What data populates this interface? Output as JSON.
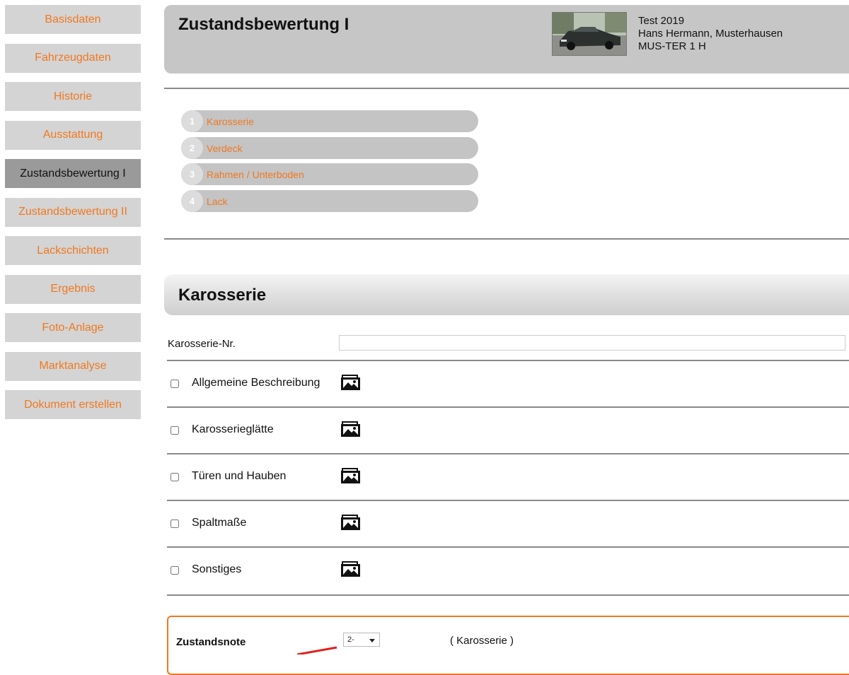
{
  "sidebar": {
    "items": [
      {
        "label": "Basisdaten"
      },
      {
        "label": "Fahrzeugdaten"
      },
      {
        "label": "Historie"
      },
      {
        "label": "Ausstattung"
      },
      {
        "label": "Zustandsbewertung I",
        "active": true
      },
      {
        "label": "Zustandsbewertung II"
      },
      {
        "label": "Lackschichten"
      },
      {
        "label": "Ergebnis"
      },
      {
        "label": "Foto-Anlage"
      },
      {
        "label": "Marktanalyse"
      },
      {
        "label": "Dokument erstellen"
      }
    ]
  },
  "header": {
    "title": "Zustandsbewertung I",
    "info_line1": "Test 2019",
    "info_line2": "Hans Hermann, Musterhausen",
    "info_line3": "MUS-TER 1 H"
  },
  "steps": [
    {
      "num": "1",
      "label": "Karosserie"
    },
    {
      "num": "2",
      "label": "Verdeck"
    },
    {
      "num": "3",
      "label": "Rahmen / Unterboden"
    },
    {
      "num": "4",
      "label": "Lack"
    }
  ],
  "section": {
    "title": "Karosserie",
    "field_label": "Karosserie-Nr.",
    "field_value": "",
    "rows": [
      {
        "label": "Allgemeine Beschreibung",
        "checked": false
      },
      {
        "label": "Karosserieglätte",
        "checked": false
      },
      {
        "label": "Türen und Hauben",
        "checked": false
      },
      {
        "label": "Spaltmaße",
        "checked": false
      },
      {
        "label": "Sonstiges",
        "checked": false
      }
    ],
    "row_icon": "photo-gallery-icon"
  },
  "grade": {
    "label": "Zustandsnote",
    "value": "2-",
    "note": "( Karosserie )"
  },
  "colors": {
    "accent": "#f07820",
    "nav_bg": "#d4d4d4",
    "nav_active_bg": "#9a9a9a",
    "header_bg": "#c6c6c6"
  }
}
